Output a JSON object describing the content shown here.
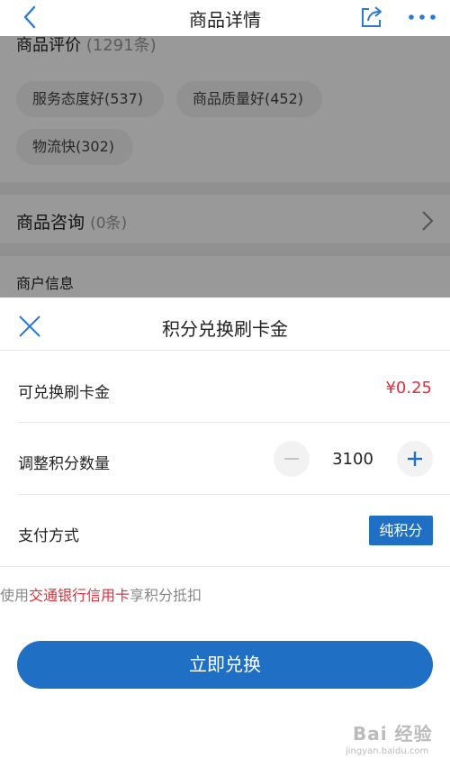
{
  "nav": {
    "title": "商品详情"
  },
  "background": {
    "review_heading": "商品评价",
    "review_count": "(1291条)",
    "tags": [
      "服务态度好(537)",
      "商品质量好(452)",
      "物流快(302)"
    ],
    "consult_label": "商品咨询",
    "consult_count": "(0条)",
    "merchant_label": "商户信息"
  },
  "sheet": {
    "title": "积分兑换刷卡金",
    "exchangeable_label": "可兑换刷卡金",
    "exchangeable_amount": "¥0.25",
    "adjust_label": "调整积分数量",
    "points_value": "3100",
    "payment_label": "支付方式",
    "payment_method": "纯积分",
    "notice_prefix": "使用",
    "notice_bank": "交通银行信用卡",
    "notice_suffix": "享积分抵扣",
    "confirm_label": "立即兑换"
  },
  "watermark": {
    "text": "Bai 经验",
    "url": "jingyan.baidu.com"
  },
  "colors": {
    "accent": "#1f6fc5",
    "price": "#e0303c",
    "overlay": "rgba(0,0,0,0.40)"
  },
  "icons": [
    "back-arrow-icon",
    "share-icon",
    "more-icon",
    "chevron-right-icon",
    "close-icon",
    "minus-icon",
    "plus-icon"
  ]
}
